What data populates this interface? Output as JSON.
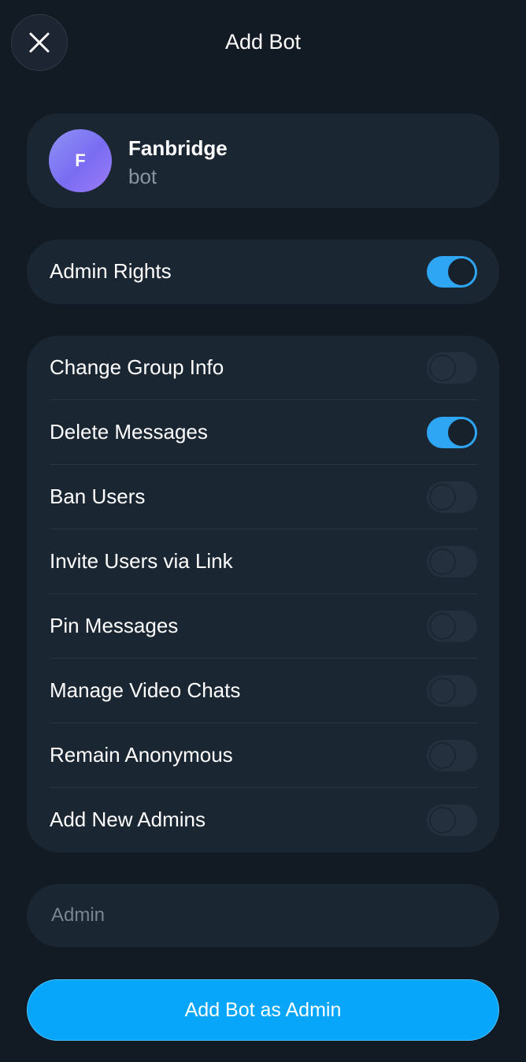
{
  "header": {
    "title": "Add Bot",
    "close_icon": "close-icon"
  },
  "bot": {
    "avatar_letter": "F",
    "name": "Fanbridge",
    "subtitle": "bot",
    "avatar_colors": [
      "#8e93f6",
      "#7a6cf2"
    ]
  },
  "admin_rights": {
    "label": "Admin Rights",
    "enabled": true
  },
  "permissions": [
    {
      "label": "Change Group Info",
      "enabled": false
    },
    {
      "label": "Delete Messages",
      "enabled": true
    },
    {
      "label": "Ban Users",
      "enabled": false
    },
    {
      "label": "Invite Users via Link",
      "enabled": false
    },
    {
      "label": "Pin Messages",
      "enabled": false
    },
    {
      "label": "Manage Video Chats",
      "enabled": false
    },
    {
      "label": "Remain Anonymous",
      "enabled": false
    },
    {
      "label": "Add New Admins",
      "enabled": false
    }
  ],
  "custom_title": {
    "placeholder": "Admin",
    "value": ""
  },
  "submit": {
    "label": "Add Bot as Admin"
  },
  "colors": {
    "background": "#121a23",
    "card": "#1b2633",
    "accent": "#07a6fb",
    "toggle_on": "#2ea6f4",
    "toggle_off": "#25303e"
  }
}
